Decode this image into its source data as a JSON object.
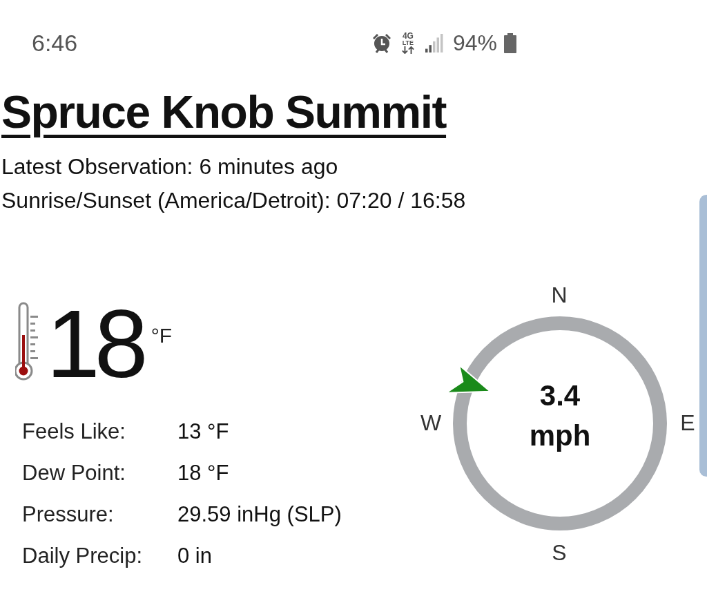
{
  "status_bar": {
    "time": "6:46",
    "network": {
      "type": "4G",
      "subtype": "LTE"
    },
    "battery": "94%"
  },
  "station": {
    "name": "Spruce Knob Summit",
    "observation": "Latest Observation: 6 minutes ago",
    "sun_times": "Sunrise/Sunset (America/Detroit): 07:20 / 16:58"
  },
  "temperature": {
    "value": "18",
    "unit": "°F"
  },
  "details": [
    {
      "label": "Feels Like:",
      "value": "13 °F"
    },
    {
      "label": "Dew Point:",
      "value": "18 °F"
    },
    {
      "label": "Pressure:",
      "value": "29.59 inHg (SLP)"
    },
    {
      "label": "Daily Precip:",
      "value": "0 in"
    }
  ],
  "wind": {
    "compass": {
      "north": "N",
      "west": "W",
      "east": "E",
      "south": "S"
    },
    "speed": "3.4",
    "unit": "mph"
  }
}
